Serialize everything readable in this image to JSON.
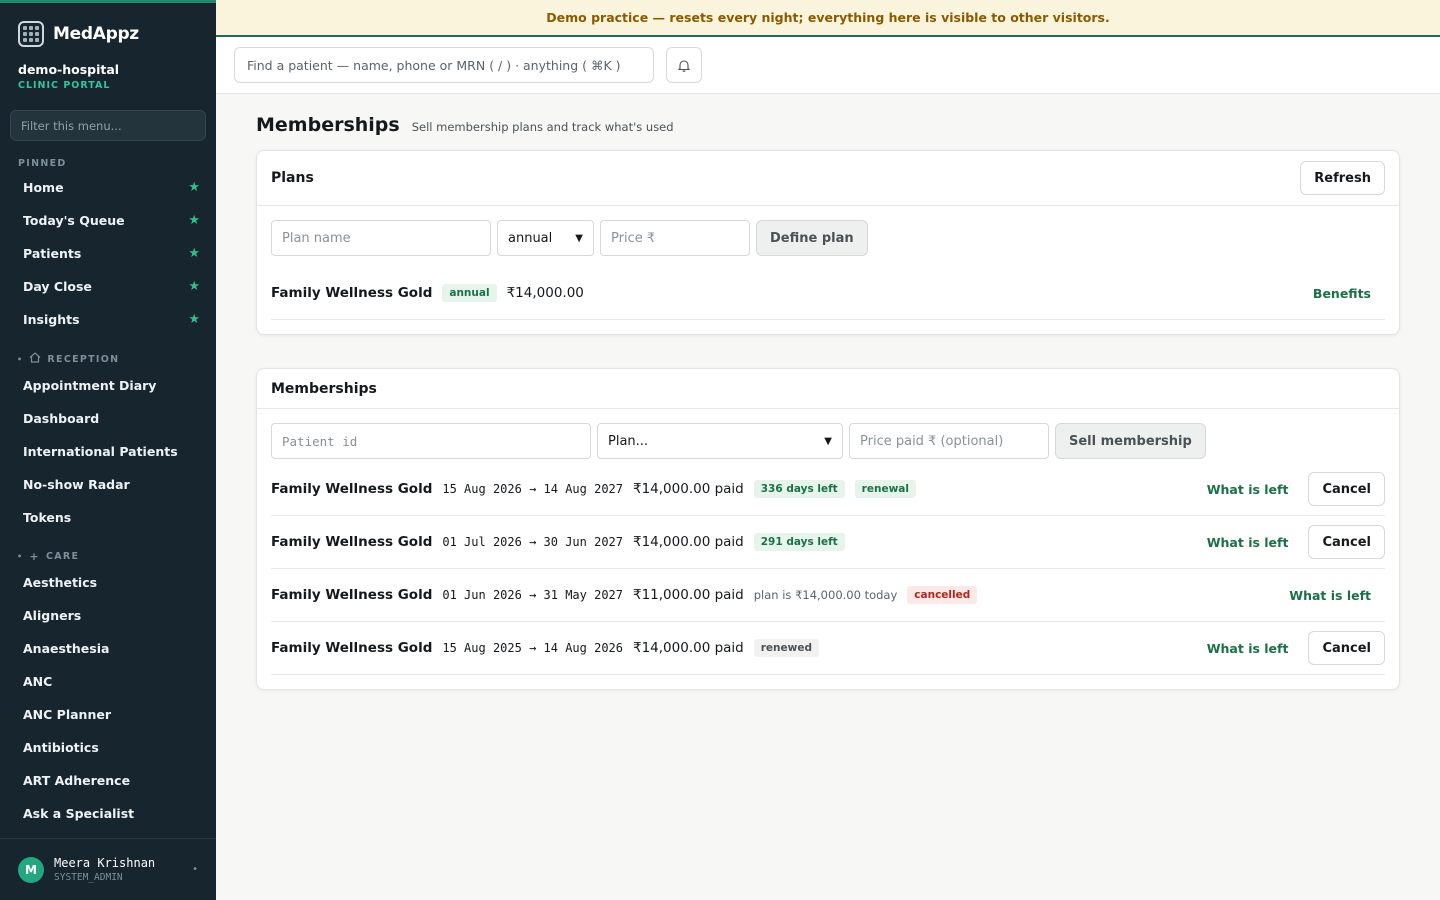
{
  "brand": {
    "name": "MedAppz",
    "tenant": "demo-hospital",
    "portal": "CLINIC PORTAL"
  },
  "sidebar": {
    "filter_placeholder": "Filter this menu...",
    "pinned_label": "PINNED",
    "pinned": [
      "Home",
      "Today's Queue",
      "Patients",
      "Day Close",
      "Insights"
    ],
    "reception_label": "RECEPTION",
    "reception": [
      "Appointment Diary",
      "Dashboard",
      "International Patients",
      "No-show Radar",
      "Tokens"
    ],
    "care_label": "CARE",
    "care": [
      "Aesthetics",
      "Aligners",
      "Anaesthesia",
      "ANC",
      "ANC Planner",
      "Antibiotics",
      "ART Adherence",
      "Ask a Specialist"
    ]
  },
  "user": {
    "initial": "M",
    "name": "Meera Krishnan",
    "role": "SYSTEM_ADMIN"
  },
  "banner": "Demo practice — resets every night; everything here is visible to other visitors.",
  "search_placeholder": "Find a patient — name, phone or MRN ( / ) · anything ( ⌘K )",
  "page": {
    "title": "Memberships",
    "subtitle": "Sell membership plans and track what's used"
  },
  "plans": {
    "title": "Plans",
    "refresh": "Refresh",
    "name_placeholder": "Plan name",
    "period_value": "annual",
    "price_placeholder": "Price ₹",
    "define": "Define plan",
    "items": [
      {
        "name": "Family Wellness Gold",
        "period": "annual",
        "price": "₹14,000.00",
        "action": "Benefits"
      }
    ]
  },
  "memberships": {
    "title": "Memberships",
    "patient_placeholder": "Patient id",
    "plan_value": "Plan...",
    "price_placeholder": "Price paid ₹ (optional)",
    "sell": "Sell membership",
    "left_label": "What is left",
    "cancel_label": "Cancel",
    "items": [
      {
        "name": "Family Wellness Gold",
        "dates": "15 Aug 2026 → 14 Aug 2027",
        "price": "₹14,000.00 paid",
        "badge1": "336 days left",
        "badge2": "renewal"
      },
      {
        "name": "Family Wellness Gold",
        "dates": "01 Jul 2026 → 30 Jun 2027",
        "price": "₹14,000.00 paid",
        "badge1": "291 days left"
      },
      {
        "name": "Family Wellness Gold",
        "dates": "01 Jun 2026 → 31 May 2027",
        "price": "₹11,000.00 paid",
        "note": "plan is ₹14,000.00 today",
        "badge_status": "cancelled"
      },
      {
        "name": "Family Wellness Gold",
        "dates": "15 Aug 2025 → 14 Aug 2026",
        "price": "₹14,000.00 paid",
        "badge_grey": "renewed"
      }
    ]
  },
  "colors": {
    "sidebar": "#17252e",
    "accent": "#1c7048",
    "star": "#2fbf8f",
    "banner": "#fbf4dc"
  }
}
